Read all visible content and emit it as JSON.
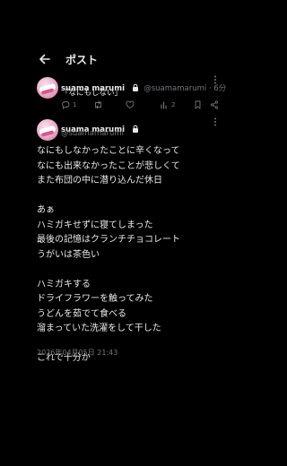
{
  "header": {
    "title": "ポスト"
  },
  "reply": {
    "name": "suama marumi",
    "handle": "@suamamarumi",
    "time": "6分",
    "text": "「なにもしない」",
    "reply_count": "1",
    "like_count": "",
    "views_count": "2"
  },
  "post": {
    "name": "suama marumi",
    "handle": "@suamamarumi",
    "lines": [
      "なにもしなかったことに辛くなって",
      "なにも出来なかったことが悲しくて",
      "また布団の中に潜り込んだ休日",
      "",
      "あぁ",
      "ハミガキせずに寝てしまった",
      "最後の記憶はクランチチョコレート",
      "うがいは茶色い",
      "",
      "ハミガキする",
      "ドライフラワーを触ってみた",
      "うどんを茹でて食べる",
      "溜まっていた洗濯をして干した",
      "",
      "これで十分か"
    ],
    "timestamp": "2026年04月05日 21:43"
  },
  "icons": {
    "back": "arrow-left-icon",
    "lock": "lock-icon",
    "more": "more-vertical-icon",
    "reply": "reply-icon",
    "repost": "repost-icon",
    "like": "heart-icon",
    "views": "views-icon",
    "bookmark": "bookmark-icon",
    "share": "share-icon"
  }
}
